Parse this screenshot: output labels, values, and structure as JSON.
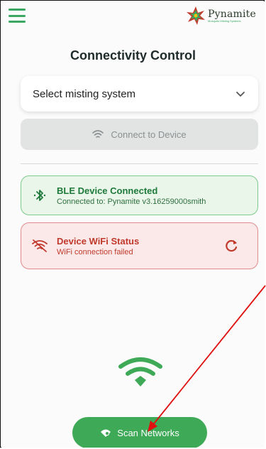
{
  "header": {
    "menu_icon": "hamburger-menu-icon",
    "logo": {
      "word": "Pynamite",
      "tagline": "Mosquito Misting Systems"
    }
  },
  "page": {
    "title": "Connectivity Control"
  },
  "select": {
    "value": "Select misting system",
    "icon": "chevron-down-icon"
  },
  "connect": {
    "label": "Connect to Device",
    "icon": "wifi-icon",
    "enabled": false
  },
  "status": {
    "ble": {
      "title": "BLE Device Connected",
      "detail": "Connected to: Pynamite v3.16259000smith",
      "icon": "bluetooth-icon",
      "color": "#1d7a3a"
    },
    "wifi": {
      "title": "Device WiFi Status",
      "detail": "WiFi connection failed",
      "icon": "wifi-off-icon",
      "action_icon": "refresh-icon",
      "color": "#c0392b"
    }
  },
  "scan": {
    "label": "Scan Networks",
    "icon": "wifi-search-icon"
  },
  "colors": {
    "accent": "#3ea957",
    "annotation_arrow": "#e01010"
  }
}
